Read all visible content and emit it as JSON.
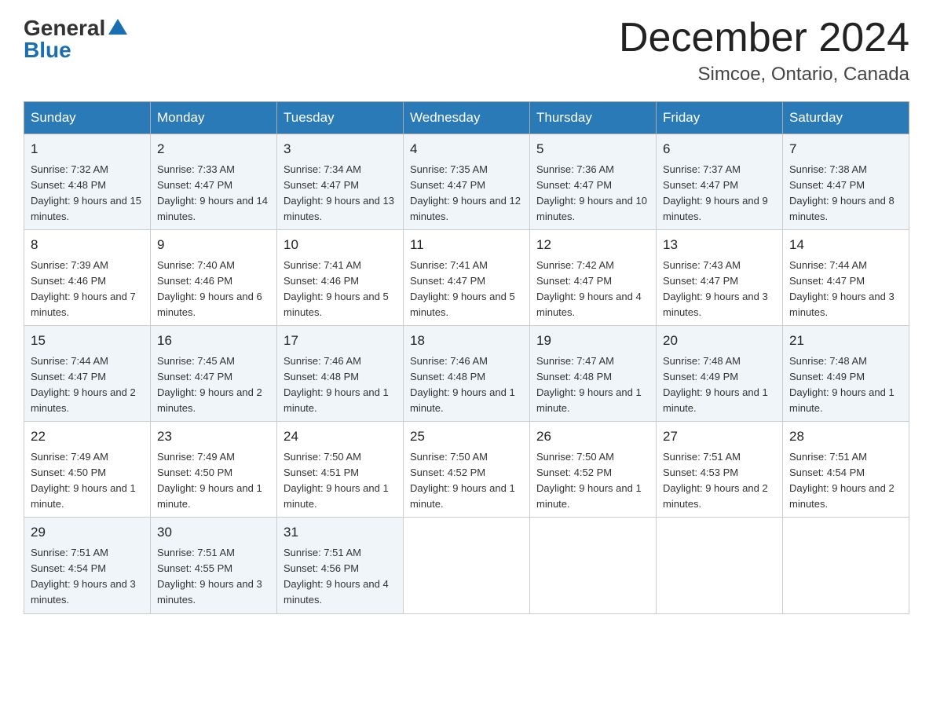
{
  "header": {
    "logo_general": "General",
    "logo_blue": "Blue",
    "month_title": "December 2024",
    "location": "Simcoe, Ontario, Canada"
  },
  "days_of_week": [
    "Sunday",
    "Monday",
    "Tuesday",
    "Wednesday",
    "Thursday",
    "Friday",
    "Saturday"
  ],
  "weeks": [
    [
      {
        "day": "1",
        "sunrise": "7:32 AM",
        "sunset": "4:48 PM",
        "daylight": "9 hours and 15 minutes."
      },
      {
        "day": "2",
        "sunrise": "7:33 AM",
        "sunset": "4:47 PM",
        "daylight": "9 hours and 14 minutes."
      },
      {
        "day": "3",
        "sunrise": "7:34 AM",
        "sunset": "4:47 PM",
        "daylight": "9 hours and 13 minutes."
      },
      {
        "day": "4",
        "sunrise": "7:35 AM",
        "sunset": "4:47 PM",
        "daylight": "9 hours and 12 minutes."
      },
      {
        "day": "5",
        "sunrise": "7:36 AM",
        "sunset": "4:47 PM",
        "daylight": "9 hours and 10 minutes."
      },
      {
        "day": "6",
        "sunrise": "7:37 AM",
        "sunset": "4:47 PM",
        "daylight": "9 hours and 9 minutes."
      },
      {
        "day": "7",
        "sunrise": "7:38 AM",
        "sunset": "4:47 PM",
        "daylight": "9 hours and 8 minutes."
      }
    ],
    [
      {
        "day": "8",
        "sunrise": "7:39 AM",
        "sunset": "4:46 PM",
        "daylight": "9 hours and 7 minutes."
      },
      {
        "day": "9",
        "sunrise": "7:40 AM",
        "sunset": "4:46 PM",
        "daylight": "9 hours and 6 minutes."
      },
      {
        "day": "10",
        "sunrise": "7:41 AM",
        "sunset": "4:46 PM",
        "daylight": "9 hours and 5 minutes."
      },
      {
        "day": "11",
        "sunrise": "7:41 AM",
        "sunset": "4:47 PM",
        "daylight": "9 hours and 5 minutes."
      },
      {
        "day": "12",
        "sunrise": "7:42 AM",
        "sunset": "4:47 PM",
        "daylight": "9 hours and 4 minutes."
      },
      {
        "day": "13",
        "sunrise": "7:43 AM",
        "sunset": "4:47 PM",
        "daylight": "9 hours and 3 minutes."
      },
      {
        "day": "14",
        "sunrise": "7:44 AM",
        "sunset": "4:47 PM",
        "daylight": "9 hours and 3 minutes."
      }
    ],
    [
      {
        "day": "15",
        "sunrise": "7:44 AM",
        "sunset": "4:47 PM",
        "daylight": "9 hours and 2 minutes."
      },
      {
        "day": "16",
        "sunrise": "7:45 AM",
        "sunset": "4:47 PM",
        "daylight": "9 hours and 2 minutes."
      },
      {
        "day": "17",
        "sunrise": "7:46 AM",
        "sunset": "4:48 PM",
        "daylight": "9 hours and 1 minute."
      },
      {
        "day": "18",
        "sunrise": "7:46 AM",
        "sunset": "4:48 PM",
        "daylight": "9 hours and 1 minute."
      },
      {
        "day": "19",
        "sunrise": "7:47 AM",
        "sunset": "4:48 PM",
        "daylight": "9 hours and 1 minute."
      },
      {
        "day": "20",
        "sunrise": "7:48 AM",
        "sunset": "4:49 PM",
        "daylight": "9 hours and 1 minute."
      },
      {
        "day": "21",
        "sunrise": "7:48 AM",
        "sunset": "4:49 PM",
        "daylight": "9 hours and 1 minute."
      }
    ],
    [
      {
        "day": "22",
        "sunrise": "7:49 AM",
        "sunset": "4:50 PM",
        "daylight": "9 hours and 1 minute."
      },
      {
        "day": "23",
        "sunrise": "7:49 AM",
        "sunset": "4:50 PM",
        "daylight": "9 hours and 1 minute."
      },
      {
        "day": "24",
        "sunrise": "7:50 AM",
        "sunset": "4:51 PM",
        "daylight": "9 hours and 1 minute."
      },
      {
        "day": "25",
        "sunrise": "7:50 AM",
        "sunset": "4:52 PM",
        "daylight": "9 hours and 1 minute."
      },
      {
        "day": "26",
        "sunrise": "7:50 AM",
        "sunset": "4:52 PM",
        "daylight": "9 hours and 1 minute."
      },
      {
        "day": "27",
        "sunrise": "7:51 AM",
        "sunset": "4:53 PM",
        "daylight": "9 hours and 2 minutes."
      },
      {
        "day": "28",
        "sunrise": "7:51 AM",
        "sunset": "4:54 PM",
        "daylight": "9 hours and 2 minutes."
      }
    ],
    [
      {
        "day": "29",
        "sunrise": "7:51 AM",
        "sunset": "4:54 PM",
        "daylight": "9 hours and 3 minutes."
      },
      {
        "day": "30",
        "sunrise": "7:51 AM",
        "sunset": "4:55 PM",
        "daylight": "9 hours and 3 minutes."
      },
      {
        "day": "31",
        "sunrise": "7:51 AM",
        "sunset": "4:56 PM",
        "daylight": "9 hours and 4 minutes."
      },
      null,
      null,
      null,
      null
    ]
  ]
}
